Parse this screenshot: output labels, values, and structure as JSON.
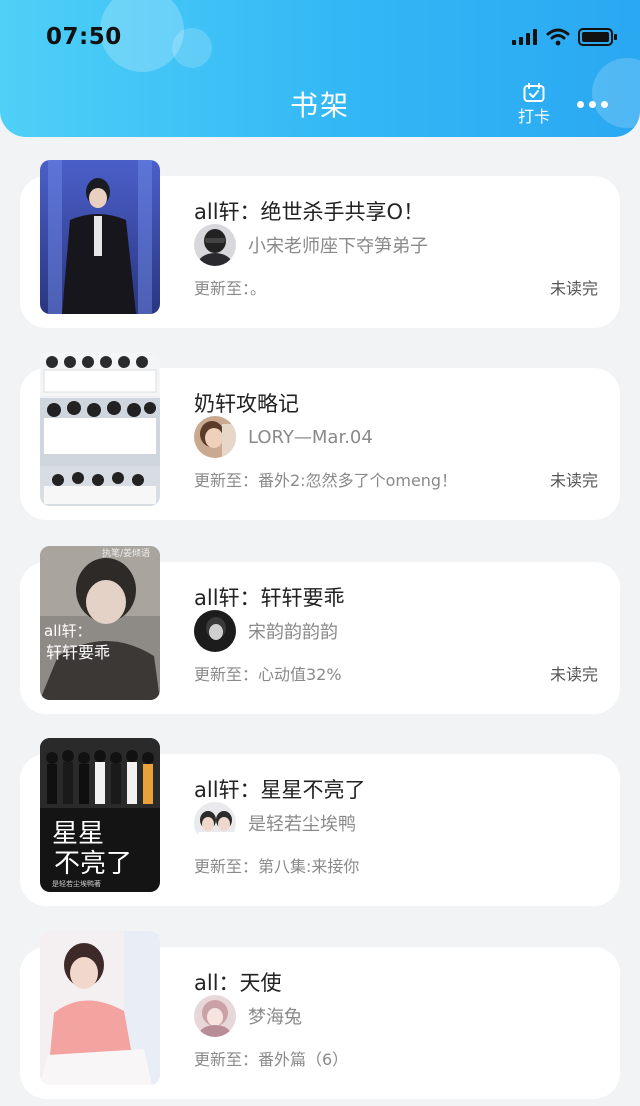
{
  "status_bar": {
    "time": "07:50"
  },
  "header": {
    "title": "书架",
    "checkin_label": "打卡"
  },
  "books": [
    {
      "title": "all轩：绝世杀手共享O！",
      "author": "小宋老师座下夺笋弟子",
      "update_label": "更新至：。",
      "unread": "未读完"
    },
    {
      "title": "奶轩攻略记",
      "author": "LORY—Mar.04",
      "update_label": "更新至：番外2:忽然多了个omeng！",
      "unread": "未读完"
    },
    {
      "title": "all轩：轩轩要乖",
      "author": "宋韵韵韵韵",
      "update_label": "更新至：心动值32%",
      "unread": "未读完",
      "cover_text": "all轩：轩轩要乖",
      "cover_watermark": "执笔/姜倾语"
    },
    {
      "title": "all轩：星星不亮了",
      "author": "是轻若尘埃鸭",
      "update_label": "更新至：第八集:来接你",
      "unread": "",
      "cover_text": "星星不亮了",
      "cover_sub": "是轻若尘埃鸭著"
    },
    {
      "title": "all：天使",
      "author": "梦海兔",
      "update_label": "更新至：番外篇（6）",
      "unread": ""
    }
  ]
}
